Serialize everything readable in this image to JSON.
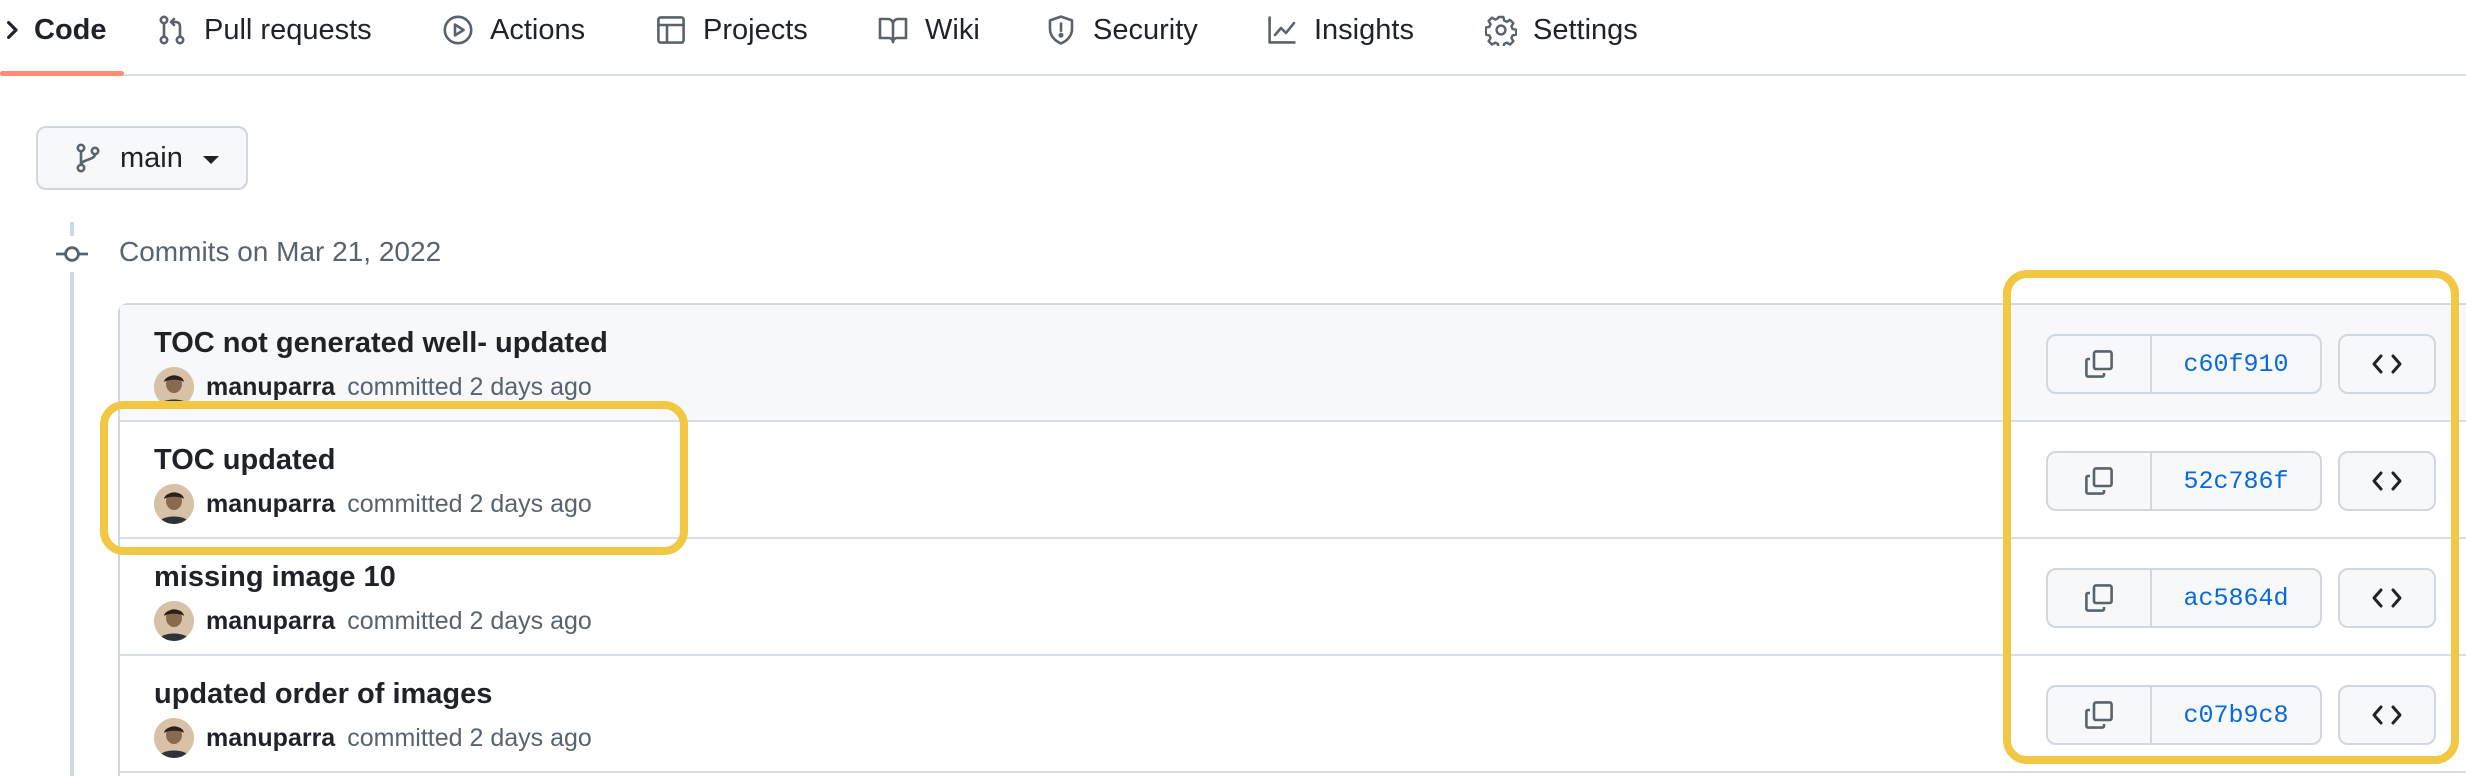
{
  "nav": {
    "tabs": [
      {
        "label": "Code",
        "icon": "code-icon",
        "active": true
      },
      {
        "label": "Pull requests",
        "icon": "git-pull-request-icon",
        "active": false
      },
      {
        "label": "Actions",
        "icon": "play-icon",
        "active": false
      },
      {
        "label": "Projects",
        "icon": "table-icon",
        "active": false
      },
      {
        "label": "Wiki",
        "icon": "book-icon",
        "active": false
      },
      {
        "label": "Security",
        "icon": "shield-icon",
        "active": false
      },
      {
        "label": "Insights",
        "icon": "graph-icon",
        "active": false
      },
      {
        "label": "Settings",
        "icon": "gear-icon",
        "active": false
      }
    ]
  },
  "branch": {
    "name": "main",
    "icon": "git-branch-icon"
  },
  "timeline": {
    "heading": "Commits on Mar 21, 2022",
    "icon": "git-commit-icon"
  },
  "commits": [
    {
      "title": "TOC not generated well- updated",
      "author": "manuparra",
      "time_text": "committed 2 days ago",
      "sha": "c60f910"
    },
    {
      "title": "TOC updated",
      "author": "manuparra",
      "time_text": "committed 2 days ago",
      "sha": "52c786f"
    },
    {
      "title": "missing image 10",
      "author": "manuparra",
      "time_text": "committed 2 days ago",
      "sha": "ac5864d"
    },
    {
      "title": "updated order of images",
      "author": "manuparra",
      "time_text": "committed 2 days ago",
      "sha": "c07b9c8"
    }
  ],
  "colors": {
    "accent_underline": "#fd8c73",
    "sha_link": "#0969da",
    "highlight": "#f2c744",
    "border": "#d0d7de"
  }
}
